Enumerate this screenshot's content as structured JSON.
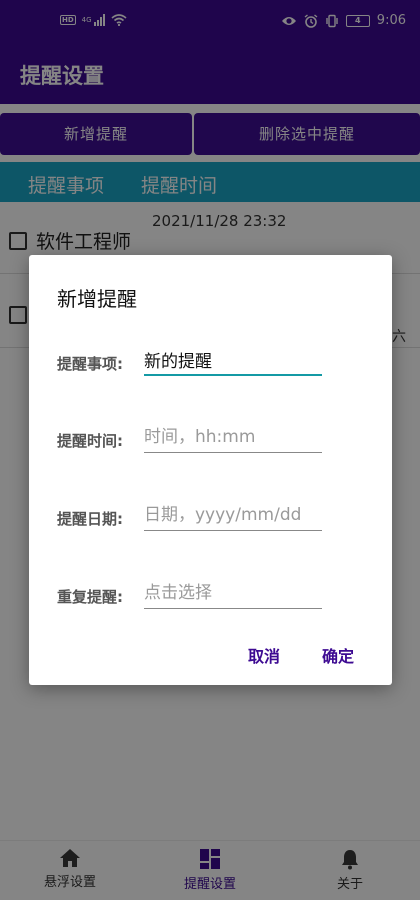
{
  "status_bar": {
    "left_icons": [
      "hd-icon",
      "signal-icon",
      "wifi-icon"
    ],
    "right_icons": [
      "eye-icon",
      "alarm-icon",
      "vibrate-icon",
      "battery-icon"
    ],
    "hd_label": "HD",
    "net_label": "4G",
    "battery_label": "4",
    "time": "9:06"
  },
  "app_bar": {
    "title": "提醒设置"
  },
  "actions": {
    "add_label": "新增提醒",
    "delete_label": "删除选中提醒"
  },
  "table_header": {
    "item": "提醒事项",
    "time": "提醒时间"
  },
  "list": {
    "rows": [
      {
        "time": "2021/11/28  23:32",
        "title": "软件工程师"
      },
      {
        "time": "",
        "title": "",
        "side": "六"
      }
    ]
  },
  "dialog": {
    "title": "新增提醒",
    "fields": [
      {
        "label": "提醒事项:",
        "value": "新的提醒",
        "placeholder": ""
      },
      {
        "label": "提醒时间:",
        "value": "",
        "placeholder": "时间，hh:mm"
      },
      {
        "label": "提醒日期:",
        "value": "",
        "placeholder": "日期，yyyy/mm/dd"
      },
      {
        "label": "重复提醒:",
        "value": "",
        "placeholder": "点击选择"
      }
    ],
    "cancel_label": "取消",
    "ok_label": "确定"
  },
  "bottom_nav": {
    "items": [
      {
        "label": "悬浮设置",
        "icon": "home-icon"
      },
      {
        "label": "提醒设置",
        "icon": "dashboard-icon"
      },
      {
        "label": "关于",
        "icon": "bell-icon"
      }
    ],
    "active_color": "#3d0a92"
  },
  "colors": {
    "primary": "#3d0a92",
    "header_teal": "#1aa6c6",
    "input_focus": "#149aa5"
  }
}
